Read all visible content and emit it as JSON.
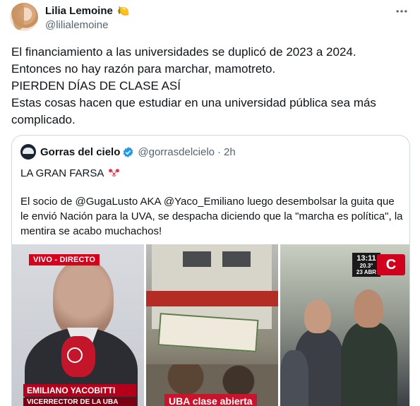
{
  "author": {
    "display_name": "Lilia Lemoine",
    "emoji": "🍋",
    "handle": "@lilialemoine",
    "avatar_icon": "profile-photo"
  },
  "more_icon": "more-horizontal-icon",
  "tweet": {
    "lines": [
      "El financiamiento a las universidades se duplicó de 2023 a 2024.",
      "Entonces no hay razón para marchar, mamotreto.",
      "PIERDEN DÍAS DE CLASE ASÍ",
      "Estas cosas hacen que estudiar en una universidad pública sea más complicado."
    ]
  },
  "quoted": {
    "display_name": "Gorras del cielo",
    "verified_icon": "verified-badge-icon",
    "verified_color": "#1d9bf0",
    "handle": "@gorrasdelcielo",
    "separator": "·",
    "time": "2h",
    "title": "LA GRAN FARSA",
    "title_emoji": "clown-face",
    "body": "El socio de @GugaLusto AKA @Yaco_Emiliano luego desembolsar la guita que le envió Nación para la UVA, se despacha diciendo que la \"marcha es política\", la mentira se acabo muchachos!",
    "media": {
      "panel1": {
        "live_tag": "VIVO - DIRECTO",
        "lower_name": "EMILIANO YACOBITTI",
        "lower_role": "VICERRECTOR DE LA UBA"
      },
      "panel2": {
        "caption": "UBA clase abierta"
      },
      "panel3": {
        "clock_time": "13:11",
        "clock_temp": "20.3°",
        "clock_date": "23 ABR",
        "channel_logo": "C"
      }
    }
  },
  "colors": {
    "text": "#0f1419",
    "muted": "#536471",
    "border": "#cfd9de",
    "accent_red": "#d6001c"
  }
}
